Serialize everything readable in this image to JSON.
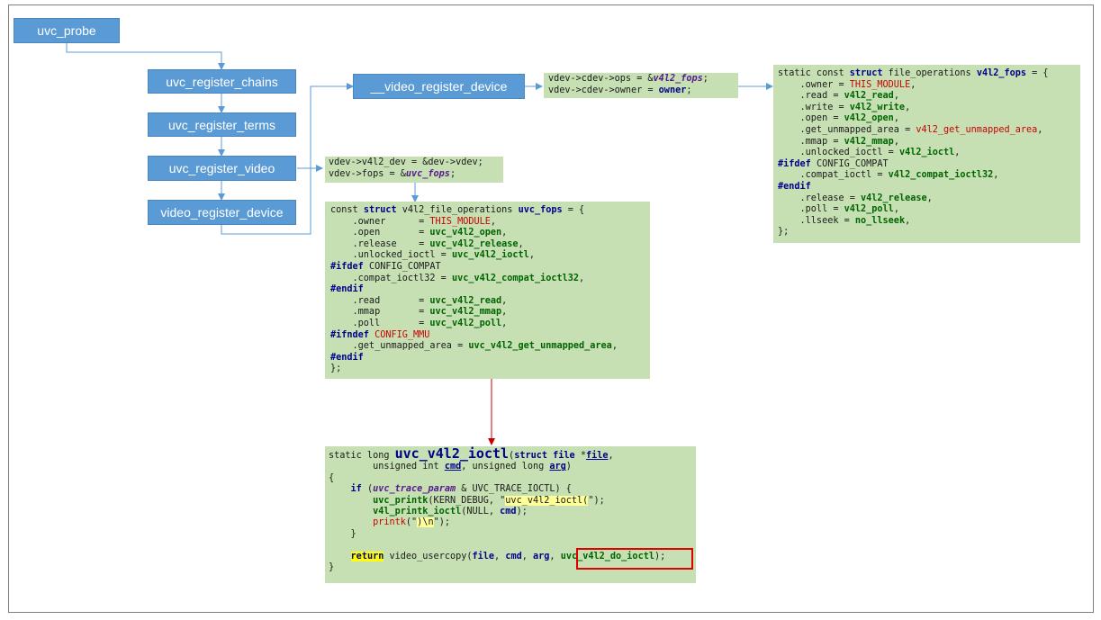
{
  "flow": {
    "uvc_probe": "uvc_probe",
    "register_chains": "uvc_register_chains",
    "register_terms": "uvc_register_terms",
    "register_video": "uvc_register_video",
    "video_register_device": "video_register_device",
    "__video_register_device": "__video_register_device"
  },
  "cdev_assign": {
    "l1_a": "vdev->cdev->ops = &",
    "l1_b": "v4l2_fops",
    "l1_c": ";",
    "l2_a": "vdev->cdev->owner = ",
    "l2_b": "owner",
    "l2_c": ";"
  },
  "vdev_assign": {
    "l1": "vdev->v4l2_dev = &dev->vdev;",
    "l2_a": "vdev->fops = &",
    "l2_b": "uvc_fops",
    "l2_c": ";"
  },
  "v4l2_fops": {
    "l1_a": "static const ",
    "l1_b": "struct",
    "l1_c": " file_operations ",
    "l1_d": "v4l2_fops",
    "l1_e": " = {",
    "owner_k": "    .owner = ",
    "owner_v": "THIS_MODULE",
    "owner_e": ",",
    "read_k": "    .read = ",
    "read_v": "v4l2_read",
    "read_e": ",",
    "write_k": "    .write = ",
    "write_v": "v4l2_write",
    "write_e": ",",
    "open_k": "    .open = ",
    "open_v": "v4l2_open",
    "open_e": ",",
    "gua_k": "    .get_unmapped_area = ",
    "gua_v": "v4l2_get_unmapped_area",
    "gua_e": ",",
    "mmap_k": "    .mmap = ",
    "mmap_v": "v4l2_mmap",
    "mmap_e": ",",
    "uioctl_k": "    .unlocked_ioctl = ",
    "uioctl_v": "v4l2_ioctl",
    "uioctl_e": ",",
    "ifdef": "#ifdef",
    "ifdef_v": " CONFIG_COMPAT",
    "compat_k": "    .compat_ioctl = ",
    "compat_v": "v4l2_compat_ioctl32",
    "compat_e": ",",
    "endif": "#endif",
    "release_k": "    .release = ",
    "release_v": "v4l2_release",
    "release_e": ",",
    "poll_k": "    .poll = ",
    "poll_v": "v4l2_poll",
    "poll_e": ",",
    "llseek_k": "    .llseek = ",
    "llseek_v": "no_llseek",
    "llseek_e": ",",
    "close": "};"
  },
  "uvc_fops": {
    "l1_a": "const ",
    "l1_b": "struct",
    "l1_c": " v4l2_file_operations ",
    "l1_d": "uvc_fops",
    "l1_e": " = {",
    "owner_k": "    .owner      = ",
    "owner_v": "THIS_MODULE",
    "owner_e": ",",
    "open_k": "    .open       = ",
    "open_v": "uvc_v4l2_open",
    "open_e": ",",
    "release_k": "    .release    = ",
    "release_v": "uvc_v4l2_release",
    "release_e": ",",
    "uioctl_k": "    .unlocked_ioctl = ",
    "uioctl_v": "uvc_v4l2_ioctl",
    "uioctl_e": ",",
    "ifdef": "#ifdef",
    "ifdef_v": " CONFIG_COMPAT",
    "compat_k": "    .compat_ioctl32 = ",
    "compat_v": "uvc_v4l2_compat_ioctl32",
    "compat_e": ",",
    "endif1": "#endif",
    "read_k": "    .read       = ",
    "read_v": "uvc_v4l2_read",
    "read_e": ",",
    "mmap_k": "    .mmap       = ",
    "mmap_v": "uvc_v4l2_mmap",
    "mmap_e": ",",
    "poll_k": "    .poll       = ",
    "poll_v": "uvc_v4l2_poll",
    "poll_e": ",",
    "ifndef": "#ifndef",
    "ifndef_v": " CONFIG_MMU",
    "gua_k": "    .get_unmapped_area = ",
    "gua_v": "uvc_v4l2_get_unmapped_area",
    "gua_e": ",",
    "endif2": "#endif",
    "close": "};"
  },
  "ioctl_func": {
    "l1_a": "static long ",
    "l1_name": "uvc_v4l2_ioctl",
    "l1_b": "(",
    "l1_c": "struct",
    "l1_d": " ",
    "l1_e": "file",
    "l1_f": " *",
    "l1_g": "file",
    "l1_h": ",",
    "l2_a": "        unsigned int ",
    "l2_b": "cmd",
    "l2_c": ", unsigned long ",
    "l2_d": "arg",
    "l2_e": ")",
    "l3": "{",
    "l4_a": "    ",
    "l4_b": "if",
    "l4_c": " (",
    "l4_d": "uvc_trace_param",
    "l4_e": " & UVC_TRACE_IOCTL) {",
    "l5_a": "        ",
    "l5_b": "uvc_printk",
    "l5_c": "(KERN_DEBUG, \"",
    "l5_d": "uvc_v4l2_ioctl(",
    "l5_e": "\");",
    "l6_a": "        ",
    "l6_b": "v4l_printk_ioctl",
    "l6_c": "(NULL, ",
    "l6_d": "cmd",
    "l6_e": ");",
    "l7_a": "        ",
    "l7_b": "printk",
    "l7_c": "(\"",
    "l7_d": ")\\n",
    "l7_e": "\");",
    "l8": "    }",
    "l10_a": "    ",
    "l10_b": "return",
    "l10_c": " video_usercopy(",
    "l10_d": "file",
    "l10_e": ", ",
    "l10_f": "cmd",
    "l10_g": ", ",
    "l10_h": "arg",
    "l10_i": ", ",
    "l10_j": "uvc_v4l2_do_ioctl",
    "l10_k": ");",
    "l11": "}"
  },
  "colors": {
    "func_box": "#5b9bd5",
    "code_box": "#c6e0b4",
    "connector": "#5b9bd5",
    "call_arrow": "#cc0000",
    "highlight_box": "#e00000"
  }
}
